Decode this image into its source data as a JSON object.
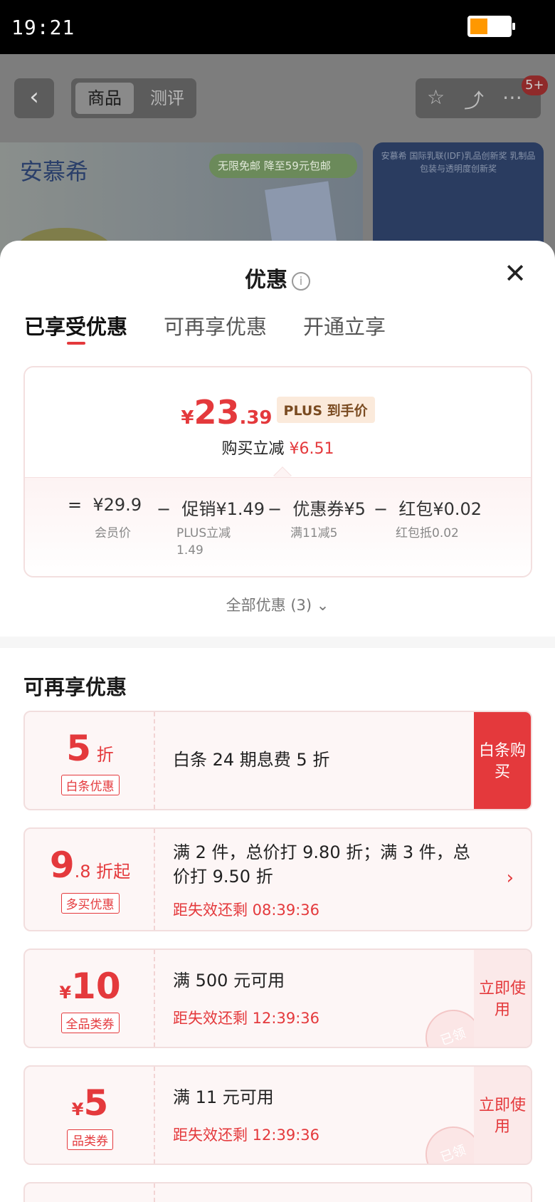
{
  "status_bar": {
    "time": "19:21",
    "battery_level": 0.45
  },
  "background": {
    "tabs": [
      "商品",
      "测评"
    ],
    "badge": "5+",
    "banner_brand": "安慕希",
    "banner_promo": "无限免邮 降至59元包邮",
    "banner2_text": "安慕希 国际乳联(IDF)乳品创新奖 乳制品包装与透明度创新奖"
  },
  "sheet": {
    "title": "优惠",
    "close": "✕",
    "tabs": [
      "已享受优惠",
      "可再享优惠",
      "开通立享"
    ],
    "active_tab": 0,
    "summary": {
      "currency": "¥",
      "price_int": "23",
      "price_dec": ".39",
      "price_tag": "PLUS 到手价",
      "reduce_label": "购买立减",
      "reduce_amount": "¥6.51",
      "formula": [
        {
          "sign": "=",
          "value": "¥29.9",
          "sub": "会员价"
        },
        {
          "sign": "−",
          "value": "促销¥1.49",
          "sub": "PLUS立减 1.49"
        },
        {
          "sign": "−",
          "value": "优惠券¥5",
          "sub": "满11减5"
        },
        {
          "sign": "−",
          "value": "红包¥0.02",
          "sub": "红包抵0.02"
        }
      ]
    },
    "all_deals": "全部优惠 (3) ⌄",
    "section_title": "可再享优惠",
    "coupons": [
      {
        "big": "5",
        "small": " 折",
        "tag": "白条优惠",
        "desc": "白条 24 期息费 5 折",
        "cta": "白条购买"
      },
      {
        "big": "9",
        "small": ".8 折起",
        "tag": "多买优惠",
        "desc": "满 2 件，总价打 9.80 折；满 3 件，总价打 9.50 折",
        "timer": "距失效还剩 08:39:36",
        "arrow": "›"
      },
      {
        "cur": "¥",
        "big": "10",
        "tag": "全品类券",
        "desc": "满 500 元可用",
        "timer": "距失效还剩 12:39:36",
        "cta": "立即使用",
        "stamp": "已领"
      },
      {
        "cur": "¥",
        "big": "5",
        "tag": "品类券",
        "desc": "满 11 元可用",
        "timer": "距失效还剩 12:39:36",
        "cta": "立即使用",
        "stamp": "已领"
      }
    ]
  }
}
